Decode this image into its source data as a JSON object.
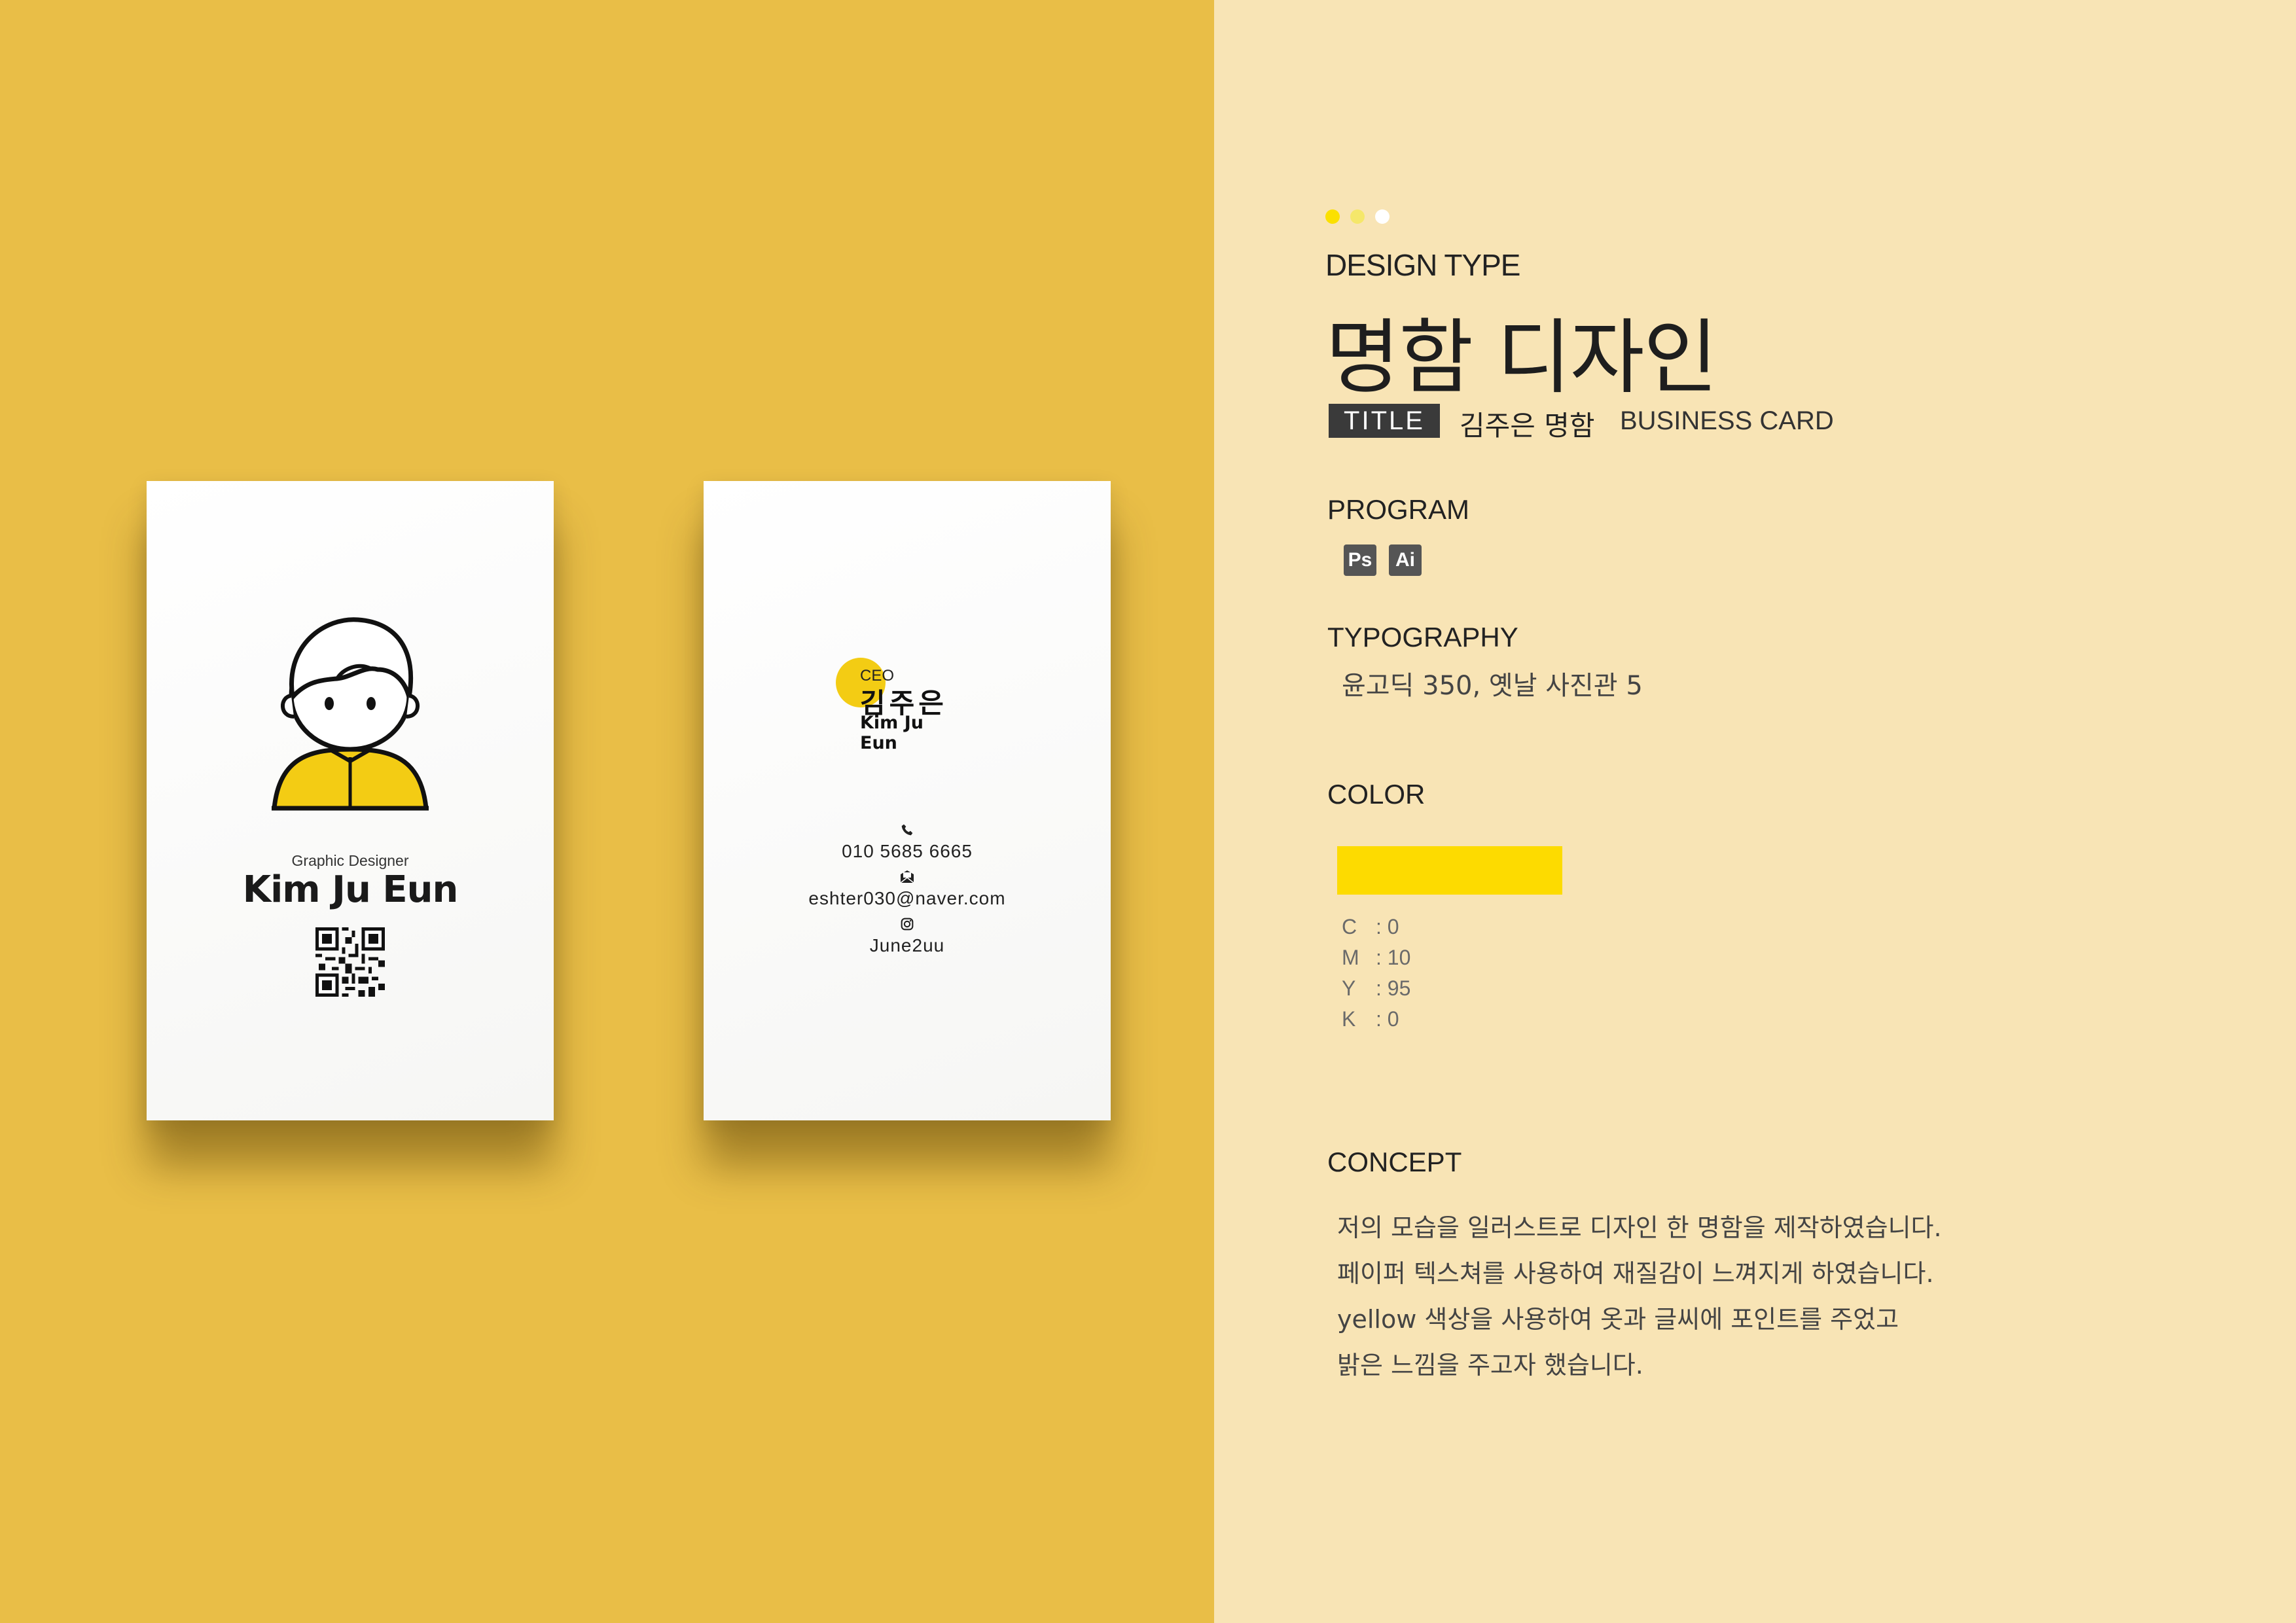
{
  "colors": {
    "left_bg": "#E9BE47",
    "right_bg": "#F8E4B5",
    "accent_yellow": "#FDDB00",
    "dots": [
      "#FBE000",
      "#F5E76A",
      "#FFFFFF"
    ]
  },
  "front_card": {
    "illustration": "boy-avatar-illustration",
    "role": "Graphic Designer",
    "name": "Kim Ju Eun",
    "qr_icon": "qr-code-icon"
  },
  "back_card": {
    "ceo_label": "CEO",
    "name_kr": "김주은",
    "name_en": "Kim Ju Eun",
    "contacts": [
      {
        "icon": "phone-icon",
        "text": "010  5685  6665"
      },
      {
        "icon": "mail-icon",
        "text": "eshter030@naver.com"
      },
      {
        "icon": "instagram-icon",
        "text": "June2uu"
      }
    ]
  },
  "info": {
    "design_type_label": "DESIGN TYPE",
    "main_title": "명함 디자인",
    "title_badge": "TITLE",
    "title_kr": "김주은 명함",
    "title_en": "BUSINESS CARD",
    "program_label": "PROGRAM",
    "programs": [
      "Ps",
      "Ai"
    ],
    "typography_label": "TYPOGRAPHY",
    "typography_value": "윤고딕 350, 옛날 사진관 5",
    "color_label": "COLOR",
    "cmyk": [
      {
        "k": "C",
        "v": ":  0"
      },
      {
        "k": "M",
        "v": ":  10"
      },
      {
        "k": "Y",
        "v": ":  95"
      },
      {
        "k": "K",
        "v": ":  0"
      }
    ],
    "concept_label": "CONCEPT",
    "concept_lines": [
      "저의 모습을 일러스트로 디자인 한 명함을 제작하였습니다.",
      "페이퍼 텍스쳐를 사용하여 재질감이 느껴지게 하였습니다.",
      "yellow 색상을 사용하여 옷과 글씨에 포인트를 주었고",
      "밝은 느낌을 주고자 했습니다."
    ]
  }
}
